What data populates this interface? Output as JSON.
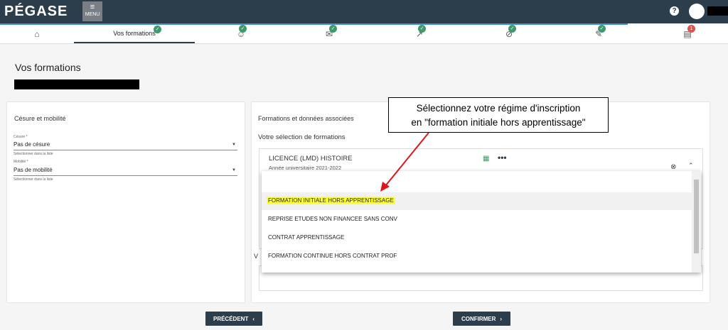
{
  "header": {
    "logo": "PÉGASE",
    "menu_label": "MENU",
    "help_glyph": "?"
  },
  "tabs": [
    {
      "name": "home",
      "icon": "home-icon",
      "glyph": "⌂",
      "check": "✓"
    },
    {
      "name": "formations",
      "label": "Vos formations",
      "check": "✓"
    },
    {
      "name": "profile",
      "icon": "smiley-icon",
      "glyph": "☺",
      "check": "✓"
    },
    {
      "name": "mail",
      "icon": "mail-icon",
      "glyph": "✉",
      "check": "✓"
    },
    {
      "name": "stats",
      "icon": "trend-icon",
      "glyph": "↗",
      "check": "✓"
    },
    {
      "name": "attach",
      "icon": "paperclip-icon",
      "glyph": "⊘",
      "check": "✓"
    },
    {
      "name": "edit",
      "icon": "pen-icon",
      "glyph": "✎",
      "check": "✓"
    },
    {
      "name": "payment",
      "icon": "card-icon",
      "glyph": "▤",
      "badge": "1"
    }
  ],
  "page": {
    "title": "Vos formations"
  },
  "cesure": {
    "title": "Césure et mobilité",
    "cesure_label": "Césure *",
    "cesure_value": "Pas de césure",
    "cesure_hint": "Sélectionner dans la liste",
    "mobilite_label": "Mobilité *",
    "mobilite_value": "Pas de mobilité",
    "mobilite_hint": "Sélectionner dans la liste"
  },
  "formations": {
    "title": "Formations et données associées",
    "selection_title": "Votre sélection de formations",
    "formation_name": "LICENCE (LMD) HISTOIRE",
    "formation_year": "Année universitaire 2021-2022",
    "second_label": "V"
  },
  "dropdown": {
    "options": [
      "FORMATION INITIALE HORS APPRENTISSAGE",
      "REPRISE ETUDES NON FINANCEE SANS CONV",
      "CONTRAT APPRENTISSAGE",
      "FORMATION CONTINUE HORS CONTRAT PROF"
    ]
  },
  "callout": {
    "line1": "Sélectionnez votre régime d'inscription",
    "line2": "en \"formation initiale hors apprentissage\""
  },
  "buttons": {
    "previous": "PRÉCÉDENT",
    "confirm": "CONFIRMER"
  },
  "colors": {
    "header_bg": "#2c3e4c",
    "check_green": "#3f9a6b",
    "highlight_yellow": "#ffff3a",
    "arrow_red": "#e0141e"
  }
}
